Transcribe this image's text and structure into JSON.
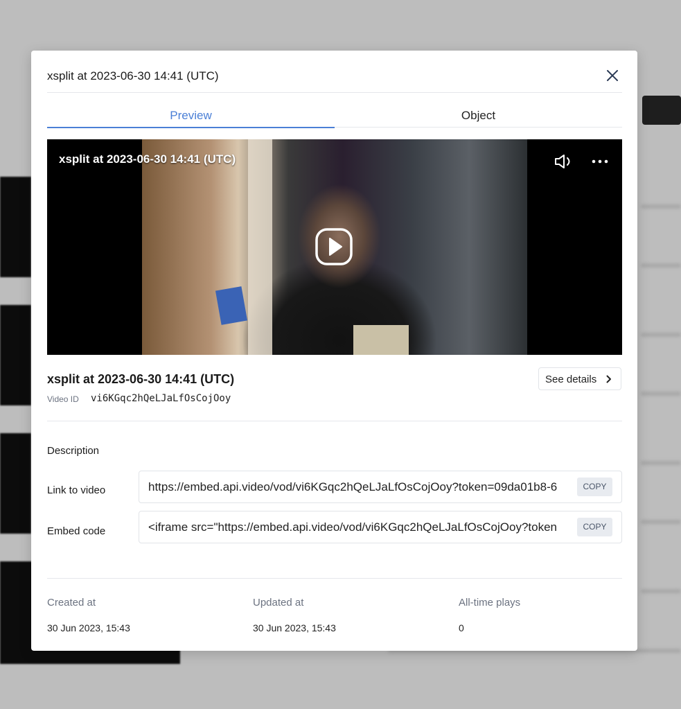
{
  "modal": {
    "title": "xsplit at 2023-06-30 14:41 (UTC)"
  },
  "tabs": [
    {
      "label": "Preview",
      "active": true
    },
    {
      "label": "Object",
      "active": false
    }
  ],
  "player": {
    "title": "xsplit at 2023-06-30 14:41 (UTC)",
    "icons": [
      "volume-icon",
      "more-icon",
      "play-icon"
    ]
  },
  "video": {
    "name": "xsplit at 2023-06-30 14:41 (UTC)",
    "id_label": "Video ID",
    "id_value": "vi6KGqc2hQeLJaLfOsCojOoy",
    "details_button": "See details"
  },
  "fields": {
    "description_label": "Description",
    "link": {
      "label": "Link to video",
      "value": "https://embed.api.video/vod/vi6KGqc2hQeLJaLfOsCojOoy?token=09da01b8-6",
      "copy_label": "COPY"
    },
    "embed": {
      "label": "Embed code",
      "value": "<iframe src=\"https://embed.api.video/vod/vi6KGqc2hQeLJaLfOsCojOoy?token",
      "copy_label": "COPY"
    }
  },
  "meta": {
    "created": {
      "label": "Created at",
      "value": "30 Jun 2023, 15:43"
    },
    "updated": {
      "label": "Updated at",
      "value": "30 Jun 2023, 15:43"
    },
    "plays": {
      "label": "All-time plays",
      "value": "0"
    }
  },
  "colors": {
    "accent": "#4a7fd6",
    "overlay": "#bdbdbd"
  }
}
